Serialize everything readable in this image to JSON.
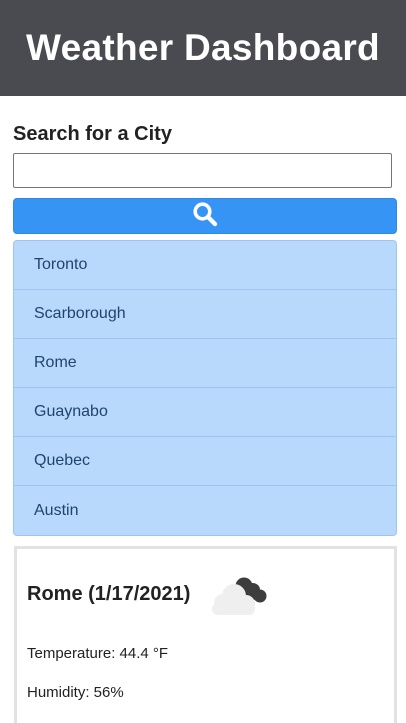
{
  "header": {
    "title": "Weather Dashboard"
  },
  "search": {
    "label": "Search for a City",
    "value": "",
    "placeholder": "",
    "button_icon": "search-icon"
  },
  "history": {
    "cities": [
      "Toronto",
      "Scarborough",
      "Rome",
      "Guaynabo",
      "Quebec",
      "Austin"
    ]
  },
  "current": {
    "title": "Rome (1/17/2021)",
    "icon": "cloud-icon",
    "temperature": "Temperature: 44.4 °F",
    "humidity": "Humidity: 56%"
  },
  "colors": {
    "header_bg": "#4a4b51",
    "button_bg": "#3694f5",
    "list_bg": "#b8d9fc",
    "list_text": "#20456b"
  }
}
